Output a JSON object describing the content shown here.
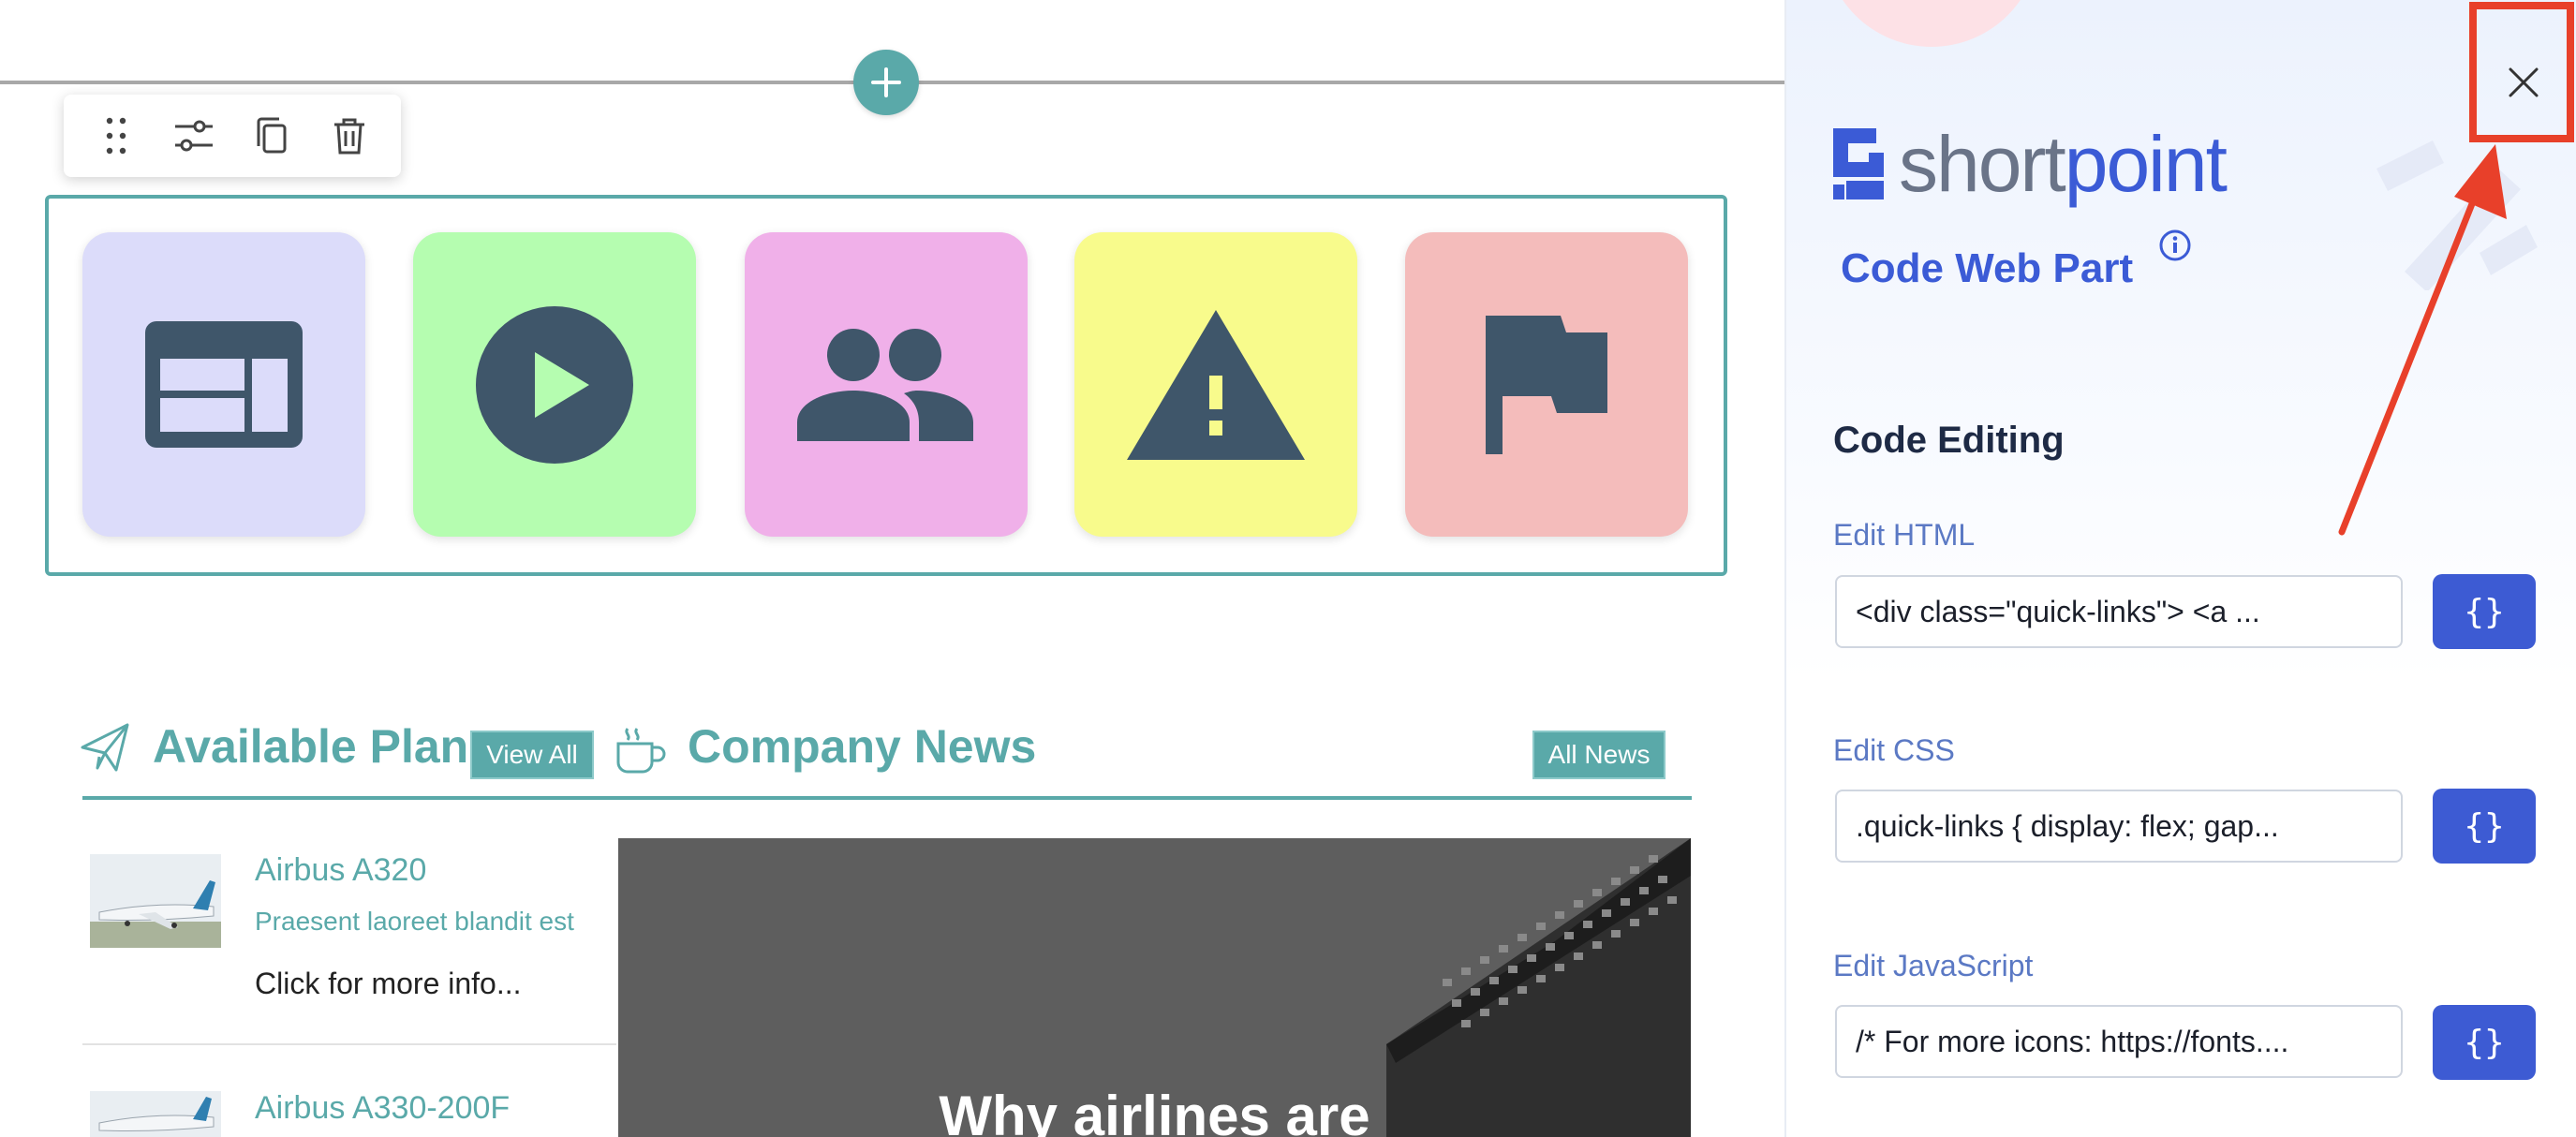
{
  "quick_links": {
    "tiles": [
      {
        "name": "layout",
        "icon": "layout-icon",
        "color": "#dcdcfa"
      },
      {
        "name": "video",
        "icon": "play-circle-icon",
        "color": "#b5fdb0"
      },
      {
        "name": "people",
        "icon": "people-icon",
        "color": "#f0b0e9"
      },
      {
        "name": "warning",
        "icon": "warning-icon",
        "color": "#f8fb8c"
      },
      {
        "name": "flag",
        "icon": "flag-icon",
        "color": "#f4bcbb"
      }
    ],
    "icon_color": "#3f566a"
  },
  "sections": {
    "planes": {
      "title": "Available Plan",
      "view_all": "View All"
    },
    "news": {
      "title": "Company News",
      "all_news": "All News"
    }
  },
  "planes": [
    {
      "title": "Airbus A320",
      "desc": "Praesent laoreet blandit est",
      "more": "Click for more info..."
    },
    {
      "title": "Airbus A330-200F"
    }
  ],
  "news": {
    "headline": "Why airlines are"
  },
  "panel": {
    "logo_part1": "short",
    "logo_part2": "point",
    "subtitle": "Code Web Part",
    "section": "Code Editing",
    "fields": [
      {
        "label": "Edit HTML",
        "value": "<div class=\"quick-links\">    <a ...",
        "button": "{}"
      },
      {
        "label": "Edit CSS",
        "value": ".quick-links {  display: flex;  gap...",
        "button": "{}"
      },
      {
        "label": "Edit JavaScript",
        "value": "/* For more icons: https://fonts....",
        "button": "{}"
      }
    ]
  },
  "colors": {
    "accent": "#5aa9a9",
    "brand": "#3b5bd6",
    "annotation": "#e8402a"
  }
}
